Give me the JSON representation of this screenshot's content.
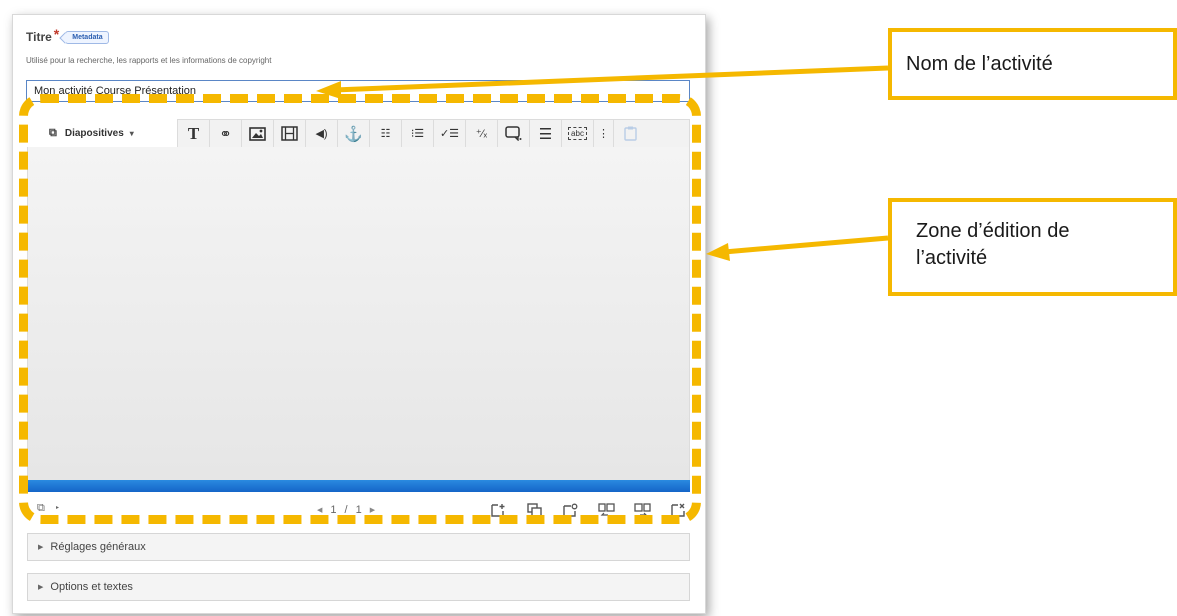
{
  "form": {
    "title_label": "Titre",
    "required_marker": "*",
    "metadata_button": "Metadata",
    "helper_text": "Utilisé pour la recherche, les rapports et les informations de copyright",
    "title_value": "Mon activité Course Présentation"
  },
  "editor": {
    "slides_menu_label": "Diapositives",
    "pager_current": "1",
    "pager_separator": "/",
    "pager_total": "1",
    "toolbar_icons": [
      "text-icon",
      "link-icon",
      "image-icon",
      "video-icon",
      "audio-icon",
      "anchor-icon",
      "fill-in-blanks-icon",
      "single-choice-icon",
      "multiple-choice-icon",
      "true-false-icon",
      "dialog-cards-icon",
      "summary-icon",
      "drag-text-icon",
      "more-icon",
      "paste-icon"
    ],
    "slide_action_icons": [
      "new-slide-icon",
      "clone-slide-icon",
      "background-icon",
      "move-left-icon",
      "move-right-icon",
      "delete-slide-icon"
    ],
    "progress_color": "#1a73d9"
  },
  "sections": {
    "general_settings": "Réglages généraux",
    "options_texts": "Options et textes"
  },
  "annotations": {
    "callout_name": "Nom de l’activité",
    "callout_zone_line1": "Zone d’édition de",
    "callout_zone_line2": "l’activité",
    "accent_color": "#f5b800"
  }
}
